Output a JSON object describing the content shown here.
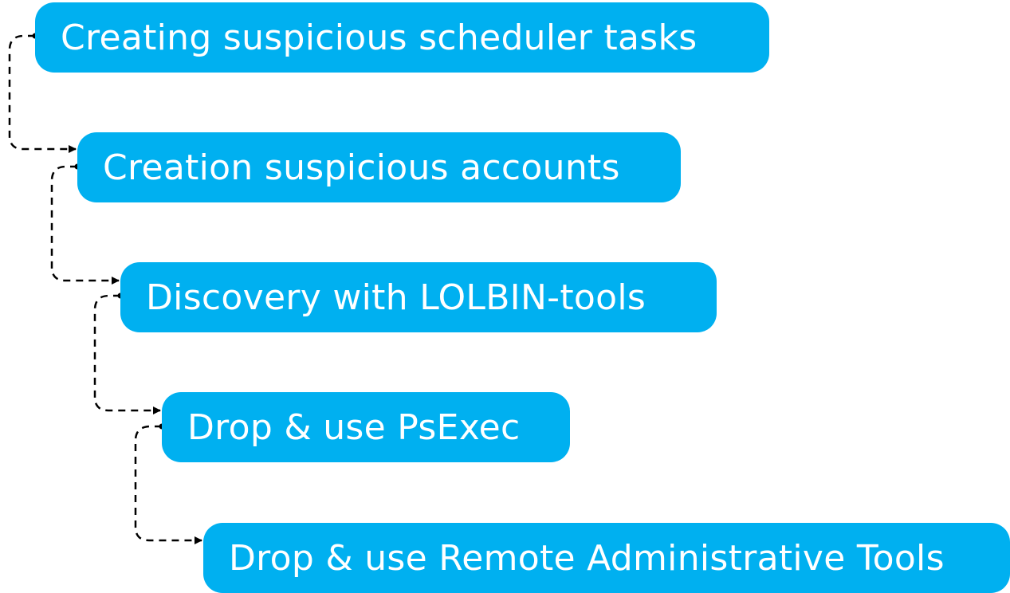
{
  "diagram": {
    "steps": [
      {
        "label": "Creating suspicious scheduler tasks"
      },
      {
        "label": "Creation suspicious accounts"
      },
      {
        "label": "Discovery with LOLBIN-tools"
      },
      {
        "label": "Drop & use PsExec"
      },
      {
        "label": "Drop & use Remote Administrative Tools"
      }
    ],
    "colors": {
      "box_fill": "#00b0f0",
      "box_text": "#ffffff",
      "connector": "#000000",
      "background": "#ffffff"
    }
  }
}
